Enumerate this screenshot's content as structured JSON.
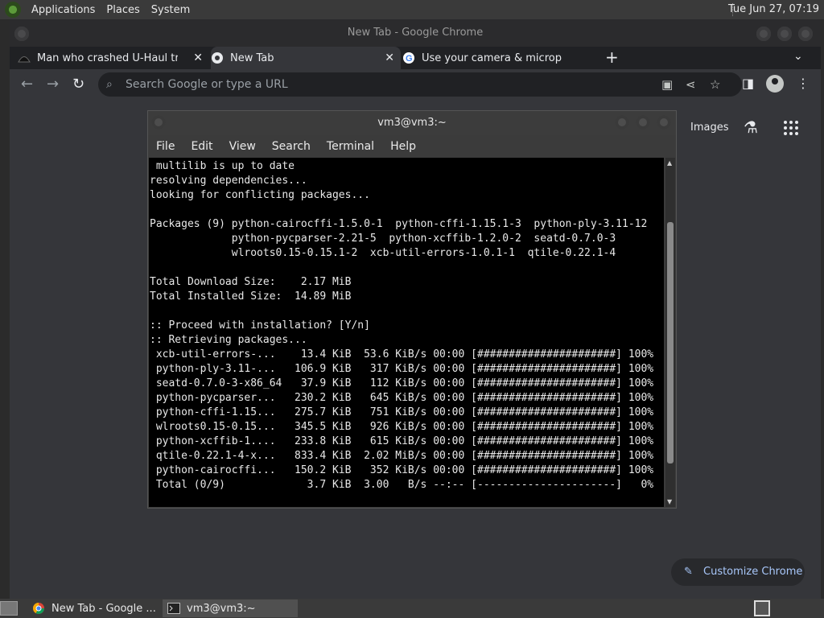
{
  "top_panel": {
    "menus": [
      "Applications",
      "Places",
      "System"
    ],
    "clock": "Tue Jun 27, 07:19"
  },
  "chrome": {
    "window_title": "New Tab - Google Chrome",
    "tabs": [
      {
        "title": "Man who crashed U-Haul truck",
        "icon": "news-favicon"
      },
      {
        "title": "New Tab",
        "icon": "chrome-favicon"
      },
      {
        "title": "Use your camera & microphone",
        "icon": "google-favicon"
      }
    ],
    "omnibox_placeholder": "Search Google or type a URL",
    "images_label": "Images",
    "customize_label": "Customize Chrome"
  },
  "terminal": {
    "title": "vm3@vm3:~",
    "menu": [
      "File",
      "Edit",
      "View",
      "Search",
      "Terminal",
      "Help"
    ],
    "lines": [
      " multilib is up to date",
      "resolving dependencies...",
      "looking for conflicting packages...",
      "",
      "Packages (9) python-cairocffi-1.5.0-1  python-cffi-1.15.1-3  python-ply-3.11-12",
      "             python-pycparser-2.21-5  python-xcffib-1.2.0-2  seatd-0.7.0-3",
      "             wlroots0.15-0.15.1-2  xcb-util-errors-1.0.1-1  qtile-0.22.1-4",
      "",
      "Total Download Size:    2.17 MiB",
      "Total Installed Size:  14.89 MiB",
      "",
      ":: Proceed with installation? [Y/n]",
      ":: Retrieving packages...",
      " xcb-util-errors-...    13.4 KiB  53.6 KiB/s 00:00 [######################] 100%",
      " python-ply-3.11-...   106.9 KiB   317 KiB/s 00:00 [######################] 100%",
      " seatd-0.7.0-3-x86_64   37.9 KiB   112 KiB/s 00:00 [######################] 100%",
      " python-pycparser...   230.2 KiB   645 KiB/s 00:00 [######################] 100%",
      " python-cffi-1.15...   275.7 KiB   751 KiB/s 00:00 [######################] 100%",
      " wlroots0.15-0.15...   345.5 KiB   926 KiB/s 00:00 [######################] 100%",
      " python-xcffib-1....   233.8 KiB   615 KiB/s 00:00 [######################] 100%",
      " qtile-0.22.1-4-x...   833.4 KiB  2.02 MiB/s 00:00 [######################] 100%",
      " python-cairocffi...   150.2 KiB   352 KiB/s 00:00 [######################] 100%",
      " Total (0/9)             3.7 KiB  3.00   B/s --:-- [----------------------]   0%"
    ],
    "scroll_position": 0.62
  },
  "taskbar": {
    "items": [
      {
        "label": "New Tab - Google ...",
        "icon": "chrome-icon"
      },
      {
        "label": "vm3@vm3:~",
        "icon": "terminal-icon"
      }
    ]
  }
}
